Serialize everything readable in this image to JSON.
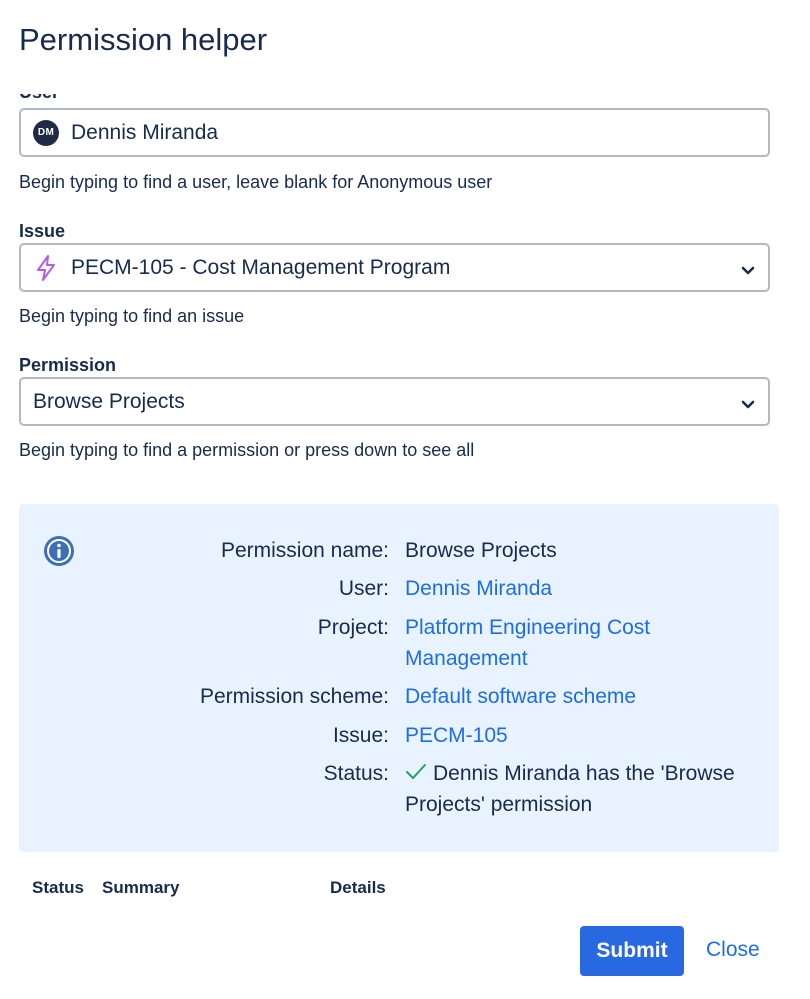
{
  "dialog": {
    "title": "Permission helper"
  },
  "user_field": {
    "label": "User",
    "avatar_initials": "DM",
    "value": "Dennis Miranda",
    "help": "Begin typing to find a user, leave blank for Anonymous user"
  },
  "issue_field": {
    "label": "Issue",
    "icon": "lightning-bolt-icon",
    "value": "PECM-105 - Cost Management Program",
    "help": "Begin typing to find an issue"
  },
  "permission_field": {
    "label": "Permission",
    "value": "Browse Projects",
    "help": "Begin typing to find a permission or press down to see all"
  },
  "result": {
    "permission_name_label": "Permission name:",
    "permission_name": "Browse Projects",
    "user_label": "User:",
    "user": "Dennis Miranda",
    "project_label": "Project:",
    "project": "Platform Engineering Cost Management",
    "scheme_label": "Permission scheme:",
    "scheme": "Default software scheme",
    "issue_label": "Issue:",
    "issue": "PECM-105",
    "status_label": "Status:",
    "status": "Dennis Miranda has the 'Browse Projects' permission"
  },
  "table": {
    "headers": [
      "Status",
      "Summary",
      "Details"
    ]
  },
  "footer": {
    "submit_label": "Submit",
    "close_label": "Close"
  },
  "colors": {
    "primary": "#2868e0",
    "link": "#1d6ee6",
    "panel_bg": "#e9f2ff",
    "success": "#22a06b"
  }
}
